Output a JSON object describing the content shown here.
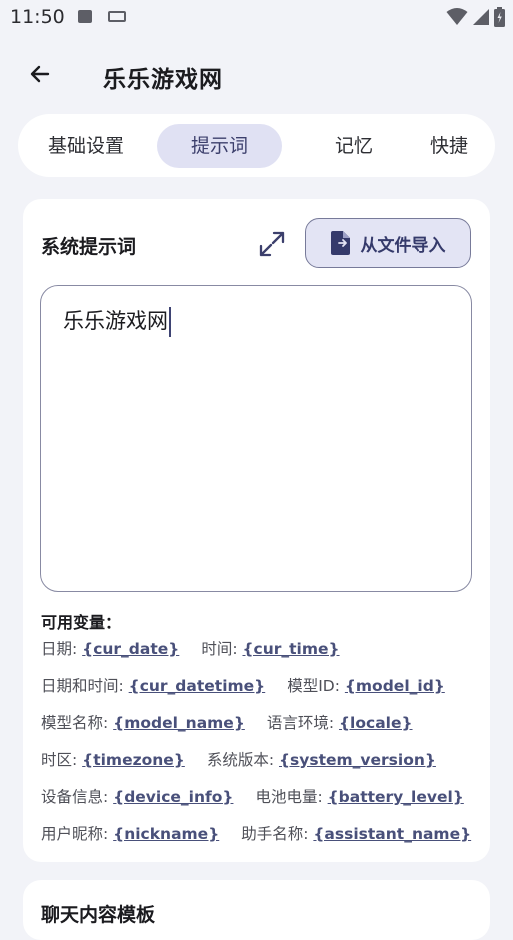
{
  "status": {
    "time": "11:50"
  },
  "header": {
    "title": "乐乐游戏网"
  },
  "tabs": [
    {
      "label": "基础设置"
    },
    {
      "label": "提示词"
    },
    {
      "label": "记忆"
    },
    {
      "label": "快捷"
    }
  ],
  "system_prompt": {
    "title": "系统提示词",
    "import_label": "从文件导入",
    "value": "乐乐游戏网"
  },
  "variables": {
    "title": "可用变量：",
    "rows": [
      [
        {
          "label": "日期: ",
          "var": "{cur_date}"
        },
        {
          "label": "时间: ",
          "var": "{cur_time}"
        }
      ],
      [
        {
          "label": "日期和时间: ",
          "var": "{cur_datetime}"
        },
        {
          "label": "模型ID: ",
          "var": "{model_id}"
        }
      ],
      [
        {
          "label": "模型名称: ",
          "var": "{model_name}"
        },
        {
          "label": "语言环境: ",
          "var": "{locale}"
        }
      ],
      [
        {
          "label": "时区: ",
          "var": "{timezone}"
        },
        {
          "label": "系统版本: ",
          "var": "{system_version}"
        }
      ],
      [
        {
          "label": "设备信息: ",
          "var": "{device_info}"
        },
        {
          "label": "电池电量: ",
          "var": "{battery_level}"
        }
      ],
      [
        {
          "label": "用户昵称: ",
          "var": "{nickname}"
        },
        {
          "label": "助手名称: ",
          "var": "{assistant_name}"
        }
      ]
    ]
  },
  "next_section": {
    "title": "聊天内容模板"
  },
  "colors": {
    "accent": "#3c3f6c",
    "tab_active_bg": "#e0e1f3",
    "link": "#49507a"
  }
}
